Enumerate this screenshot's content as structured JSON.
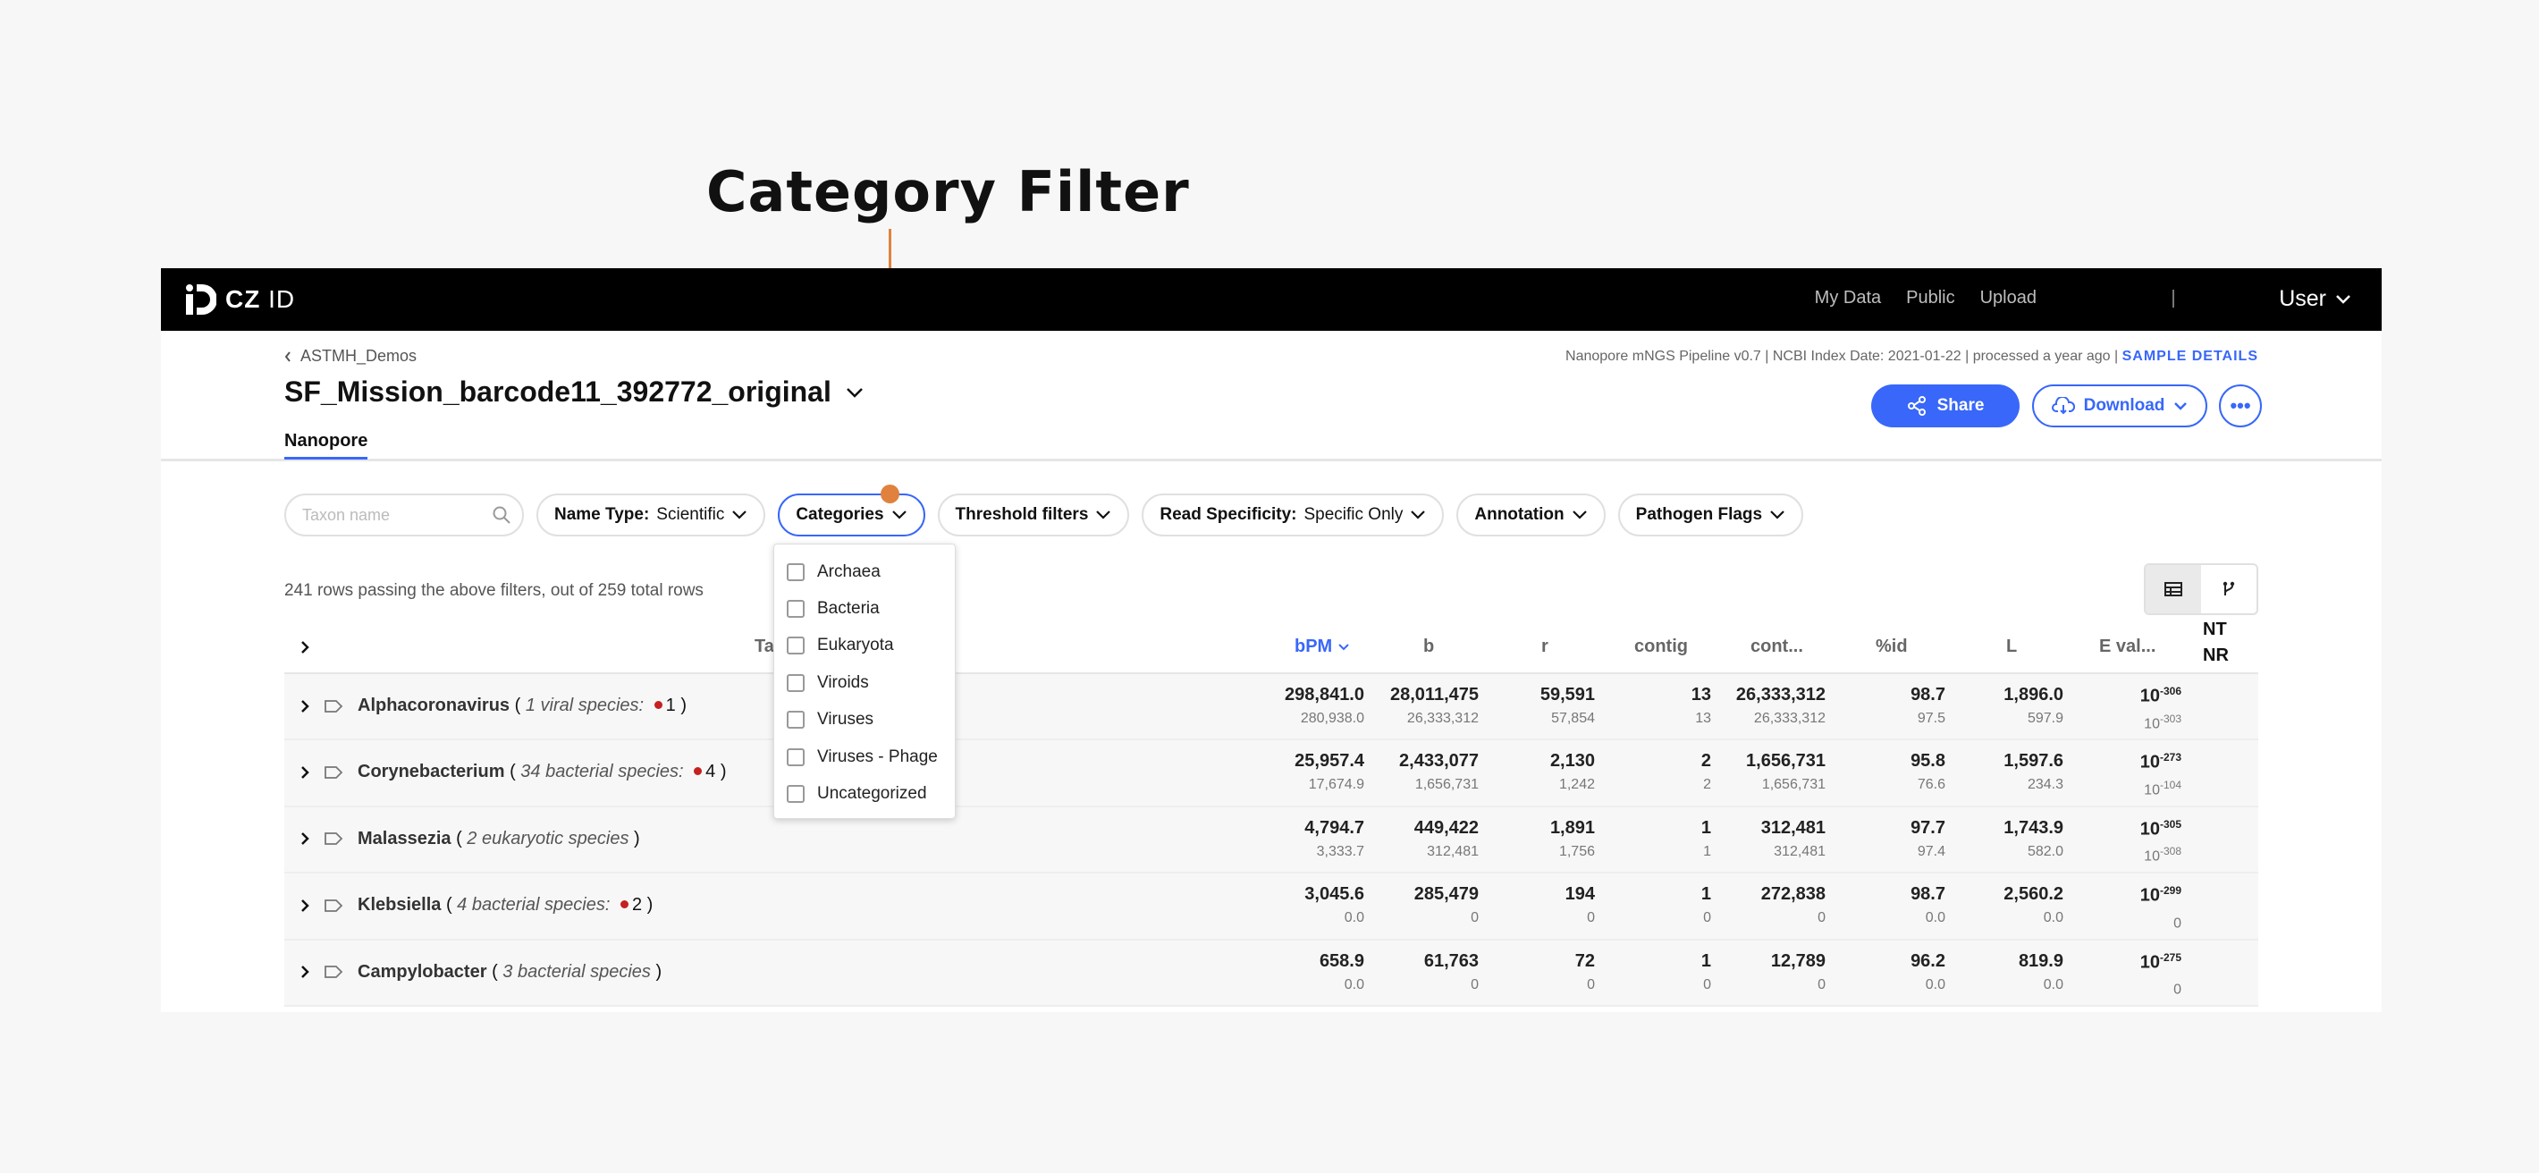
{
  "callout": {
    "title": "Category Filter"
  },
  "topbar": {
    "logo_bold": "CZ",
    "logo_light": "ID",
    "nav": [
      "My Data",
      "Public",
      "Upload"
    ],
    "user_label": "User"
  },
  "header": {
    "breadcrumb": "ASTMH_Demos",
    "sample_name": "SF_Mission_barcode11_392772_original",
    "tab": "Nanopore",
    "pipeline_info": "Nanopore mNGS Pipeline v0.7 | NCBI Index Date: 2021-01-22 | processed a year ago |",
    "sample_details": "SAMPLE DETAILS",
    "share_label": "Share",
    "download_label": "Download"
  },
  "filters": {
    "search_placeholder": "Taxon name",
    "name_type_label": "Name Type:",
    "name_type_value": "Scientific",
    "categories_label": "Categories",
    "threshold_label": "Threshold filters",
    "read_specificity_label": "Read Specificity:",
    "read_specificity_value": "Specific Only",
    "annotation_label": "Annotation",
    "pathogen_flags_label": "Pathogen Flags"
  },
  "categories_dropdown": [
    "Archaea",
    "Bacteria",
    "Eukaryota",
    "Viroids",
    "Viruses",
    "Viruses - Phage",
    "Uncategorized"
  ],
  "rows_info": "241 rows passing the above filters, out of 259 total rows",
  "table": {
    "columns": [
      "Ta",
      "bPM",
      "b",
      "r",
      "contig",
      "cont...",
      "%id",
      "L",
      "E val..."
    ],
    "nt_nr": [
      "NT",
      "NR"
    ],
    "rows": [
      {
        "name": "Alphacoronavirus",
        "desc_pre": "( ",
        "desc": "1 viral species:",
        "flag_count": "1",
        "desc_post": " )",
        "bpm": [
          "298,841.0",
          "280,938.0"
        ],
        "b": [
          "28,011,475",
          "26,333,312"
        ],
        "r": [
          "59,591",
          "57,854"
        ],
        "contig": [
          "13",
          "13"
        ],
        "cont": [
          "26,333,312",
          "26,333,312"
        ],
        "pid": [
          "98.7",
          "97.5"
        ],
        "l": [
          "1,896.0",
          "597.9"
        ],
        "e_top_base": "10",
        "e_top_exp": "-306",
        "e_bot_base": "10",
        "e_bot_exp": "-303"
      },
      {
        "name": "Corynebacterium",
        "desc_pre": "( ",
        "desc": "34 bacterial species:",
        "flag_count": "4",
        "desc_post": " )",
        "bpm": [
          "25,957.4",
          "17,674.9"
        ],
        "b": [
          "2,433,077",
          "1,656,731"
        ],
        "r": [
          "2,130",
          "1,242"
        ],
        "contig": [
          "2",
          "2"
        ],
        "cont": [
          "1,656,731",
          "1,656,731"
        ],
        "pid": [
          "95.8",
          "76.6"
        ],
        "l": [
          "1,597.6",
          "234.3"
        ],
        "e_top_base": "10",
        "e_top_exp": "-273",
        "e_bot_base": "10",
        "e_bot_exp": "-104"
      },
      {
        "name": "Malassezia",
        "desc_pre": "( ",
        "desc": "2 eukaryotic species",
        "flag_count": "",
        "desc_post": " )",
        "bpm": [
          "4,794.7",
          "3,333.7"
        ],
        "b": [
          "449,422",
          "312,481"
        ],
        "r": [
          "1,891",
          "1,756"
        ],
        "contig": [
          "1",
          "1"
        ],
        "cont": [
          "312,481",
          "312,481"
        ],
        "pid": [
          "97.7",
          "97.4"
        ],
        "l": [
          "1,743.9",
          "582.0"
        ],
        "e_top_base": "10",
        "e_top_exp": "-305",
        "e_bot_base": "10",
        "e_bot_exp": "-308"
      },
      {
        "name": "Klebsiella",
        "desc_pre": "( ",
        "desc": "4 bacterial species:",
        "flag_count": "2",
        "desc_post": " )",
        "bpm": [
          "3,045.6",
          "0.0"
        ],
        "b": [
          "285,479",
          "0"
        ],
        "r": [
          "194",
          "0"
        ],
        "contig": [
          "1",
          "0"
        ],
        "cont": [
          "272,838",
          "0"
        ],
        "pid": [
          "98.7",
          "0.0"
        ],
        "l": [
          "2,560.2",
          "0.0"
        ],
        "e_top_base": "10",
        "e_top_exp": "-299",
        "e_bot_base": "0",
        "e_bot_exp": ""
      },
      {
        "name": "Campylobacter",
        "desc_pre": "( ",
        "desc": "3 bacterial species",
        "flag_count": "",
        "desc_post": " )",
        "bpm": [
          "658.9",
          "0.0"
        ],
        "b": [
          "61,763",
          "0"
        ],
        "r": [
          "72",
          "0"
        ],
        "contig": [
          "1",
          "0"
        ],
        "cont": [
          "12,789",
          "0"
        ],
        "pid": [
          "96.2",
          "0.0"
        ],
        "l": [
          "819.9",
          "0.0"
        ],
        "e_top_base": "10",
        "e_top_exp": "-275",
        "e_bot_base": "0",
        "e_bot_exp": ""
      }
    ]
  },
  "colors": {
    "accent": "#3867fa",
    "callout": "#e0823d",
    "flag": "#c42121"
  }
}
